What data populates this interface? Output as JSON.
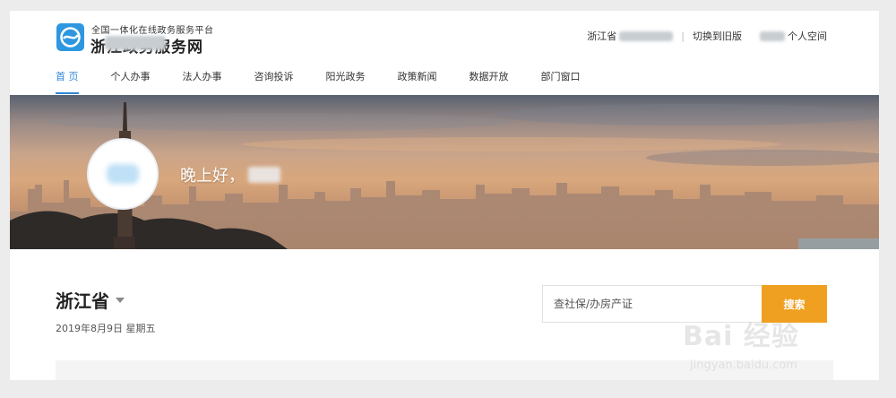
{
  "header": {
    "logo_subtitle": "全国一体化在线政务服务平台",
    "logo_title": "浙江政务服务网",
    "location": "浙江省",
    "switch_old_label": "切换到旧版",
    "personal_space_label": "个人空间"
  },
  "nav": {
    "items": [
      {
        "label": "首 页"
      },
      {
        "label": "个人办事"
      },
      {
        "label": "法人办事"
      },
      {
        "label": "咨询投诉"
      },
      {
        "label": "阳光政务"
      },
      {
        "label": "政策新闻"
      },
      {
        "label": "数据开放"
      },
      {
        "label": "部门窗口"
      }
    ]
  },
  "banner": {
    "greeting": "晚上好，"
  },
  "region": {
    "name": "浙江省",
    "date": "2019年8月9日  星期五"
  },
  "search": {
    "placeholder": "查社保/办房产证",
    "button_label": "搜索"
  },
  "watermark": {
    "text": "Bai 经验",
    "url": "jingyan.baidu.com"
  },
  "colors": {
    "accent": "#2e86d8",
    "search_button": "#f0a020"
  }
}
